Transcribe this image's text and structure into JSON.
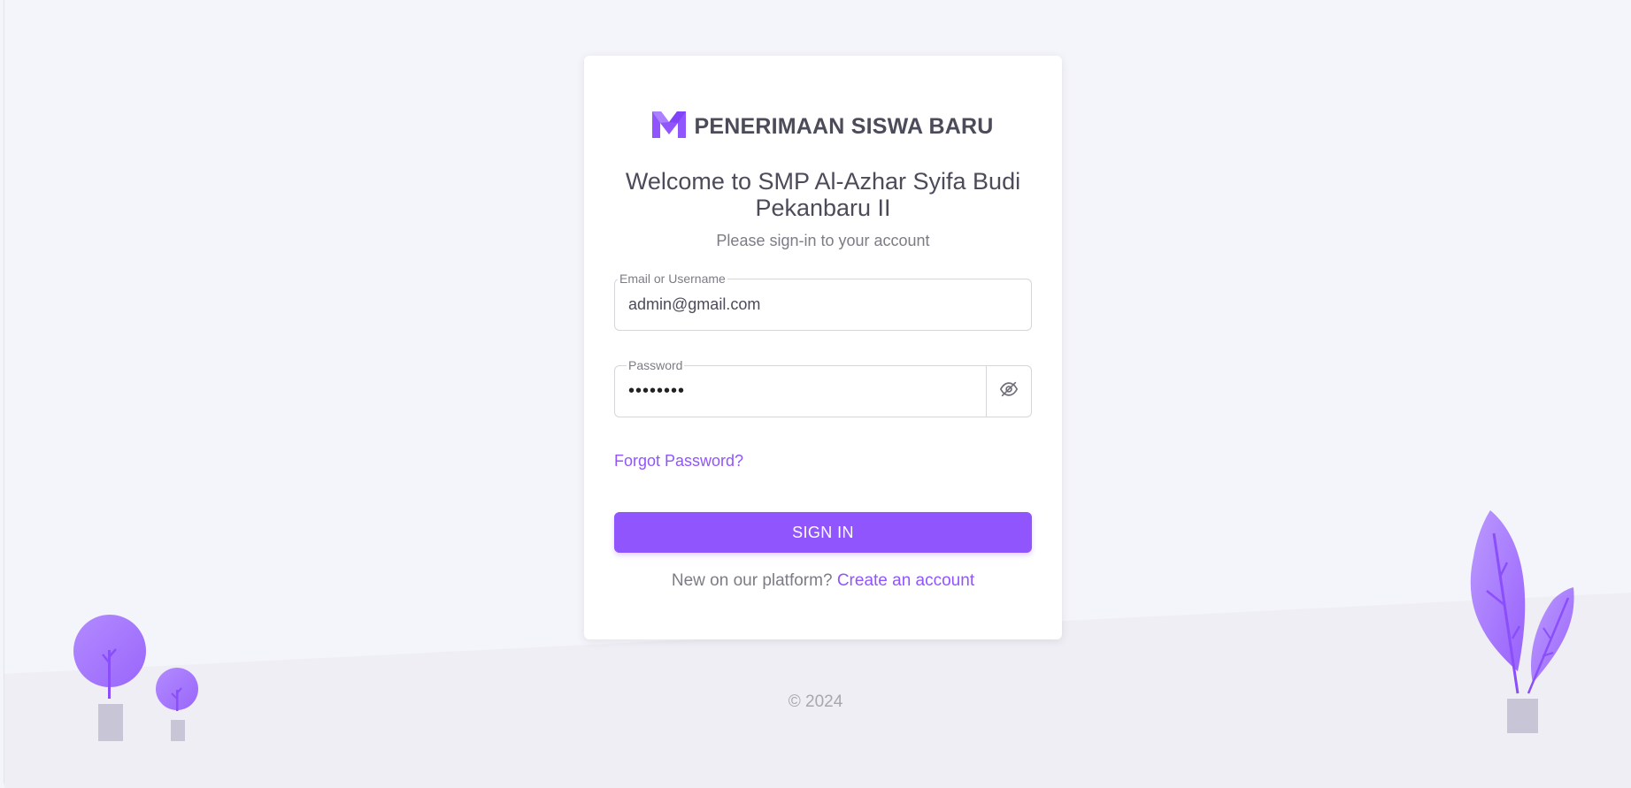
{
  "brand": {
    "name": "PENERIMAAN SISWA BARU",
    "logo_icon": "m-logo-icon",
    "accent_color": "#9155fd"
  },
  "login": {
    "welcome": "Welcome to SMP Al-Azhar Syifa Budi Pekanbaru II",
    "subtitle": "Please sign-in to your account",
    "email_label": "Email or Username",
    "email_value": "admin@gmail.com",
    "password_label": "Password",
    "password_value": "••••••••",
    "password_toggle_icon": "eye-off-icon",
    "forgot_label": "Forgot Password?",
    "signin_label": "SIGN IN",
    "register_prompt": "New on our platform?",
    "register_link": "Create an account"
  },
  "footer": {
    "copyright": "© 2024"
  }
}
